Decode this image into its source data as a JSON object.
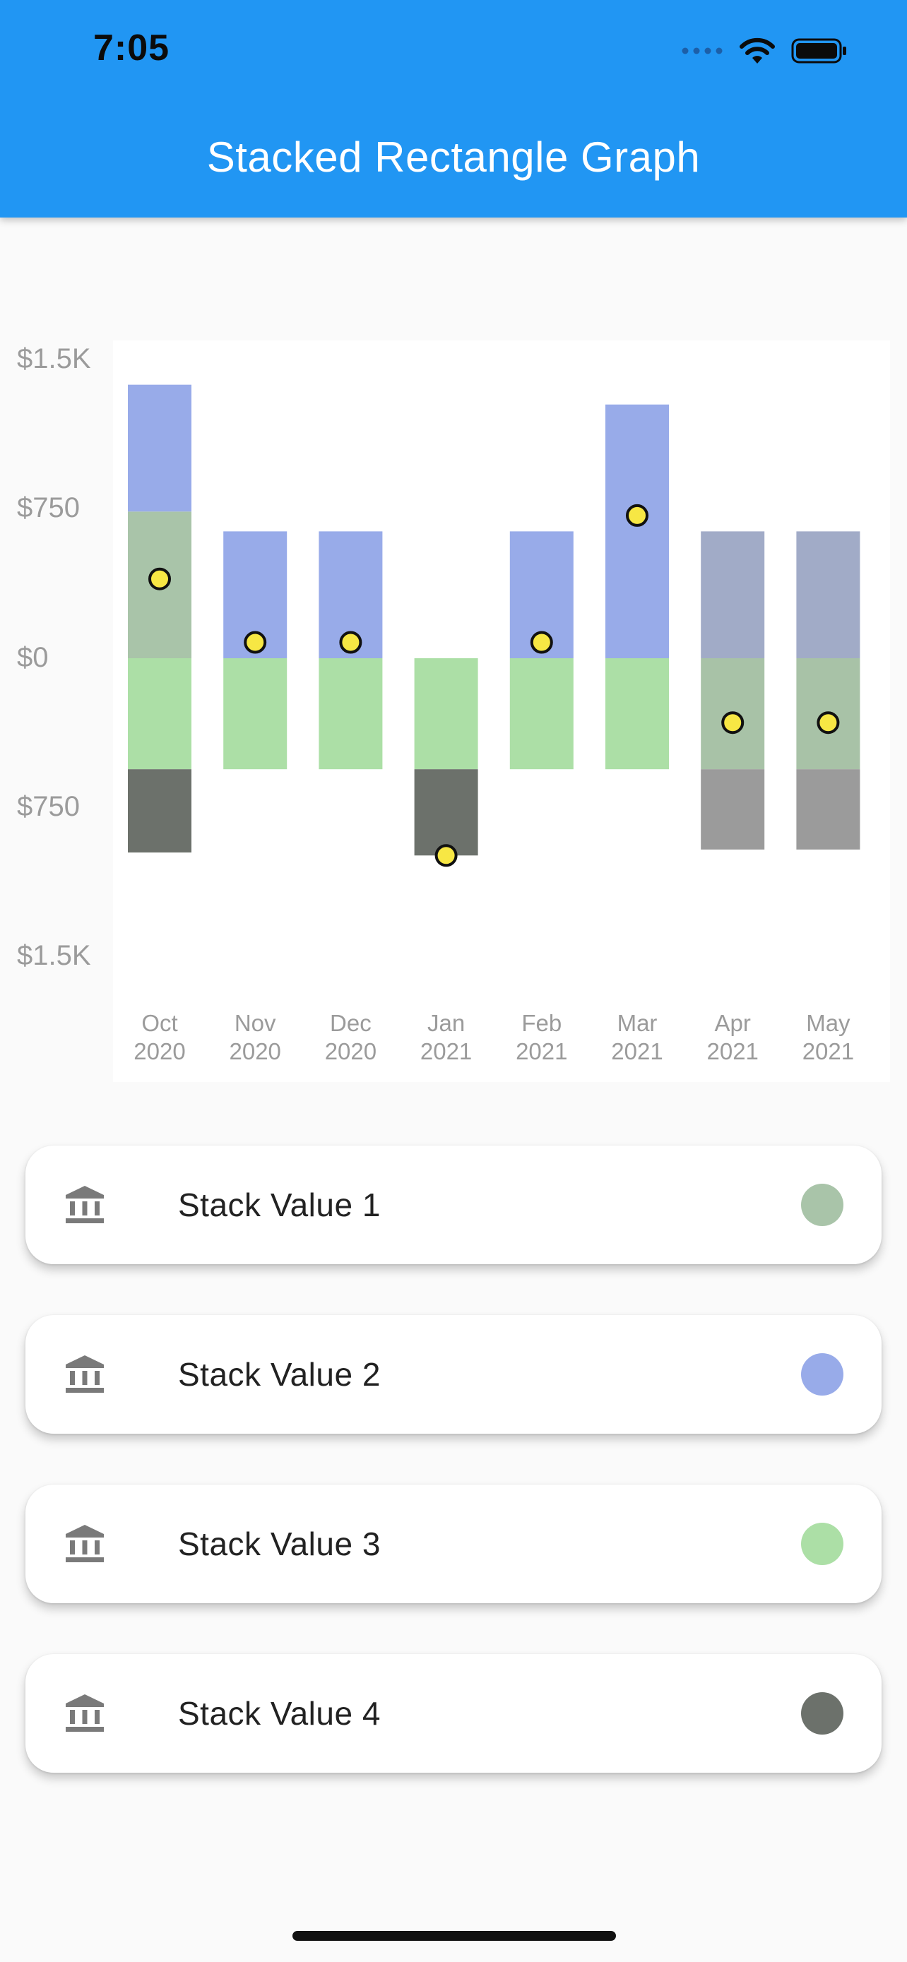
{
  "status_bar": {
    "time": "7:05",
    "icons": [
      "signal-dots-icon",
      "wifi-icon",
      "battery-icon"
    ]
  },
  "app_bar": {
    "title": "Stacked Rectangle Graph",
    "color": "#2196f3"
  },
  "chart_data": {
    "type": "bar",
    "stacked": true,
    "categories": [
      [
        "Oct",
        "2020"
      ],
      [
        "Nov",
        "2020"
      ],
      [
        "Dec",
        "2020"
      ],
      [
        "Jan",
        "2021"
      ],
      [
        "Feb",
        "2021"
      ],
      [
        "Mar",
        "2021"
      ],
      [
        "Apr",
        "2021"
      ],
      [
        "May",
        "2021"
      ]
    ],
    "y_ticks": [
      {
        "label": "$1.5K",
        "value": 1500
      },
      {
        "label": "$750",
        "value": 750
      },
      {
        "label": "$0",
        "value": 0
      },
      {
        "label": "$750",
        "value": -750
      },
      {
        "label": "$1.5K",
        "value": -1500
      }
    ],
    "ylim": [
      -1500,
      1500
    ],
    "grid": false,
    "series": [
      {
        "name": "Stack Value 1",
        "color": "#a9c4a9",
        "values": [
          740,
          0,
          0,
          0,
          0,
          0,
          0,
          0
        ]
      },
      {
        "name": "Stack Value 2",
        "color": "#98abe9",
        "values": [
          640,
          640,
          640,
          0,
          640,
          1280,
          640,
          640
        ]
      },
      {
        "name": "Stack Value 3",
        "color": "#acdfa6",
        "values": [
          -560,
          -560,
          -560,
          -560,
          -560,
          -560,
          -560,
          -560
        ]
      },
      {
        "name": "Stack Value 4",
        "color": "#6c716b",
        "values": [
          -420,
          0,
          0,
          -435,
          0,
          0,
          -405,
          -405
        ]
      }
    ],
    "dimmed_categories": [
      6,
      7
    ],
    "dimmed_colors": {
      "Stack Value 2": "#a1abc7",
      "Stack Value 3": "#a8c2a7",
      "Stack Value 4": "#9b9b9b"
    },
    "markers": {
      "color": "#f7e744",
      "stroke": "#111111",
      "values": [
        400,
        80,
        80,
        -995,
        80,
        720,
        -325,
        -325
      ]
    }
  },
  "legend_cards": [
    {
      "label": "Stack Value 1",
      "icon": "bank-icon",
      "color": "#a9c4a9"
    },
    {
      "label": "Stack Value 2",
      "icon": "bank-icon",
      "color": "#98abe9"
    },
    {
      "label": "Stack Value 3",
      "icon": "bank-icon",
      "color": "#acdfa6"
    },
    {
      "label": "Stack Value 4",
      "icon": "bank-icon",
      "color": "#6c716b"
    }
  ]
}
